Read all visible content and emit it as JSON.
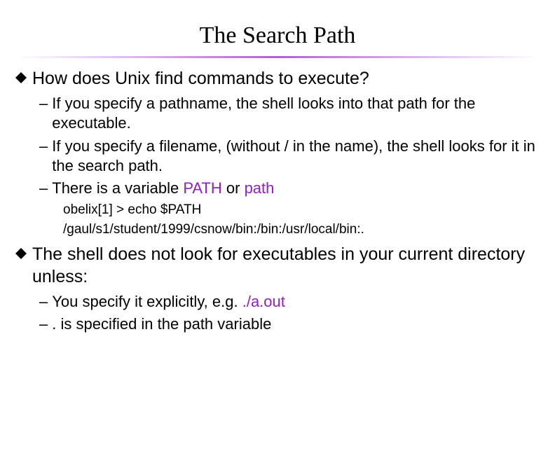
{
  "title": "The Search Path",
  "sections": [
    {
      "heading": "How does Unix find commands to execute?",
      "sub": [
        {
          "dash": "–",
          "text": "If you specify a pathname, the shell looks into that path for the executable."
        },
        {
          "dash": "–",
          "text": "If you specify a filename, (without / in the name), the shell looks for it in the search path."
        },
        {
          "dash": "–",
          "prefix": "There is a variable ",
          "hl1": "PATH",
          "mid": " or ",
          "hl2": "path"
        }
      ],
      "code": [
        "obelix[1] > echo $PATH",
        "/gaul/s1/student/1999/csnow/bin:/bin:/usr/local/bin:."
      ]
    },
    {
      "heading": "The shell does not look for executables in your current directory unless:",
      "sub": [
        {
          "dash": "–",
          "prefix": "You specify it explicitly, e.g. ",
          "hl1": "./a.out"
        },
        {
          "dash": "–",
          "prefix": ". is specified in the path variable"
        }
      ]
    }
  ]
}
